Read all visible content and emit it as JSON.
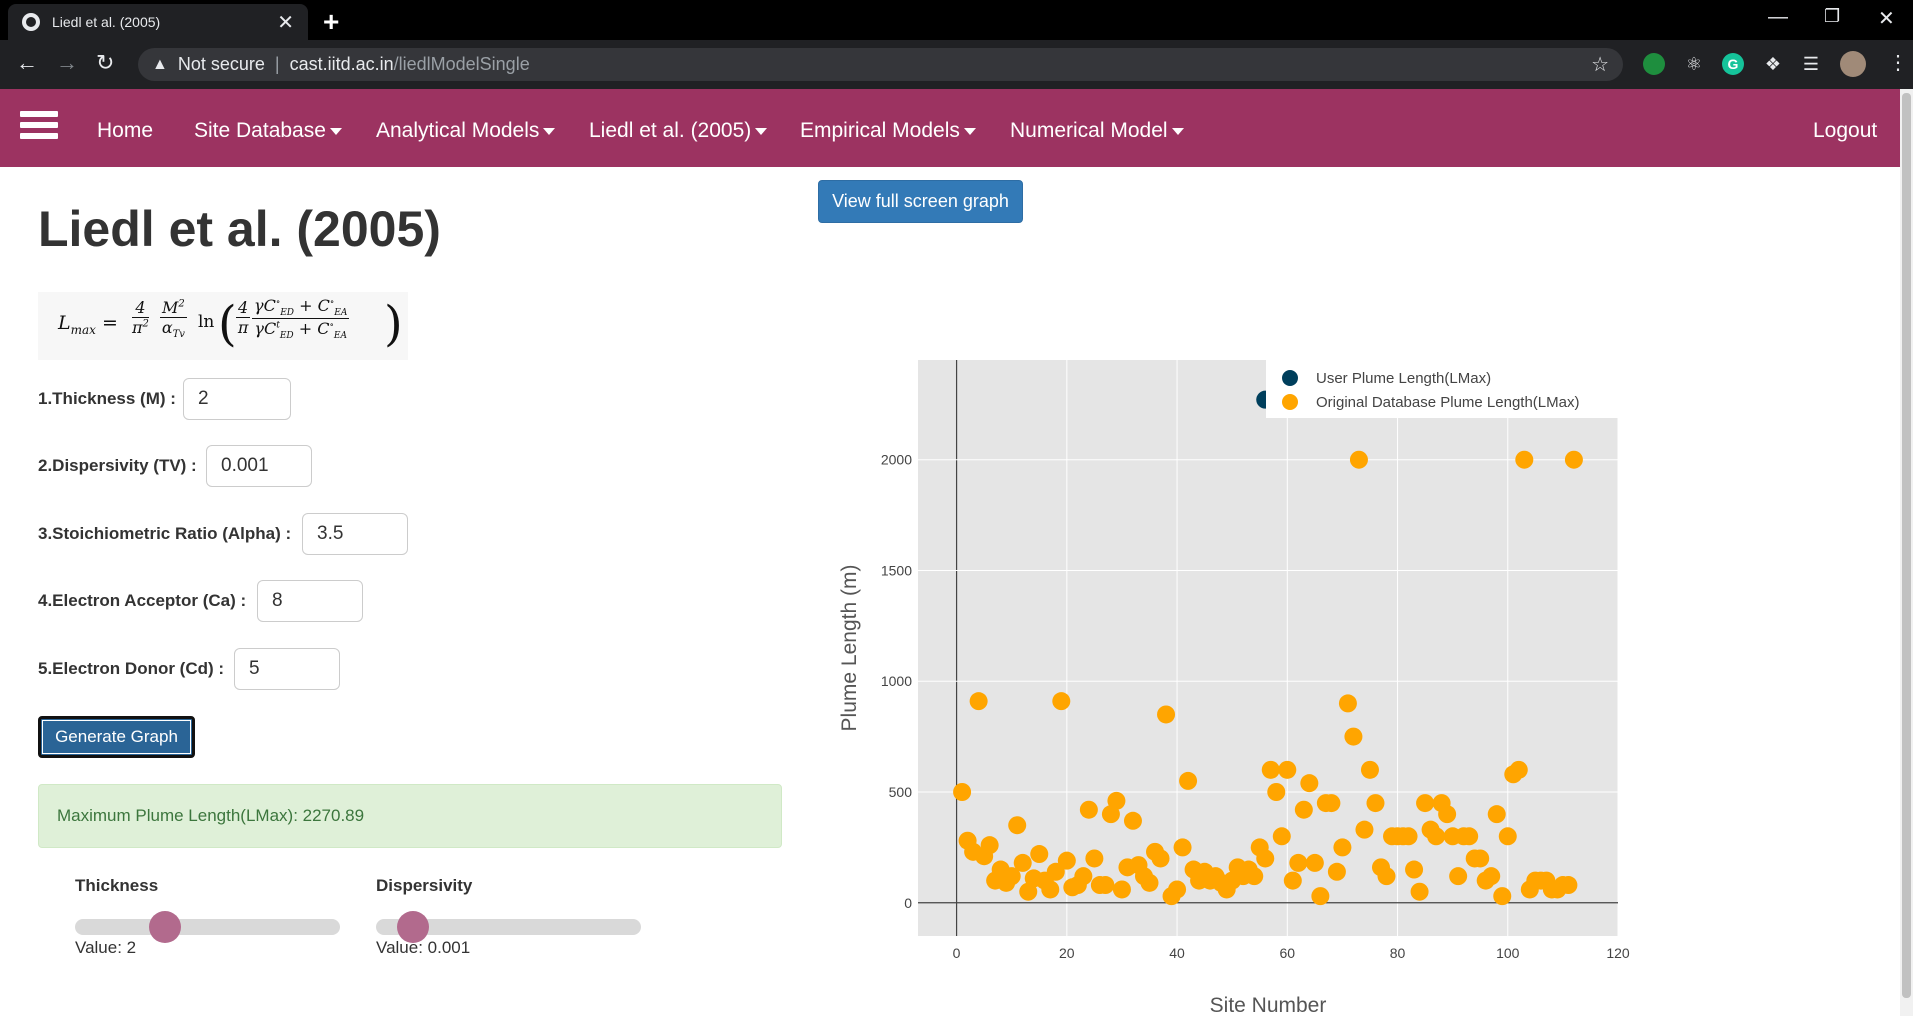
{
  "browser": {
    "tab_title": "Liedl et al. (2005)",
    "tab_close": "✕",
    "new_tab": "+",
    "security": "Not secure",
    "url_host": "cast.iitd.ac.in",
    "url_path": "/liedlModelSingle"
  },
  "nav": {
    "items": [
      {
        "label": "Home",
        "dropdown": false
      },
      {
        "label": "Site Database",
        "dropdown": true
      },
      {
        "label": "Analytical Models",
        "dropdown": true
      },
      {
        "label": "Liedl et al. (2005)",
        "dropdown": true
      },
      {
        "label": "Empirical Models",
        "dropdown": true
      },
      {
        "label": "Numerical Model",
        "dropdown": true
      }
    ],
    "logout": "Logout",
    "color": "#9c3361"
  },
  "page": {
    "title": "Liedl et al. (2005)",
    "fields": [
      {
        "label": "1.Thickness (M) :",
        "value": "2"
      },
      {
        "label": "2.Dispersivity (TV) :",
        "value": "0.001"
      },
      {
        "label": "3.Stoichiometric Ratio (Alpha) :",
        "value": "3.5"
      },
      {
        "label": "4.Electron Acceptor (Ca) :",
        "value": "8"
      },
      {
        "label": "5.Electron Donor (Cd) :",
        "value": "5"
      }
    ],
    "generate_button": "Generate Graph",
    "result_text": "Maximum Plume Length(LMax): 2270.89",
    "sliders": [
      {
        "label": "Thickness",
        "value_text": "Value: 2",
        "position": 0.34
      },
      {
        "label": "Dispersivity",
        "value_text": "Value: 0.001",
        "position": 0.14
      }
    ],
    "fullscreen_button": "View full screen graph"
  },
  "chart_data": {
    "type": "scatter",
    "xlabel": "Site Number",
    "ylabel": "Plume Length (m)",
    "xlim": [
      -7,
      120
    ],
    "ylim": [
      -150,
      2450
    ],
    "xticks": [
      0,
      20,
      40,
      60,
      80,
      100,
      120
    ],
    "yticks": [
      0,
      500,
      1000,
      1500,
      2000
    ],
    "legend_position": "top-right",
    "series": [
      {
        "name": "User Plume Length(LMax)",
        "color": "#003f5c",
        "points": [
          [
            56,
            2270.89
          ]
        ]
      },
      {
        "name": "Original Database Plume Length(LMax)",
        "color": "#ffa500",
        "points": [
          [
            1,
            500
          ],
          [
            2,
            280
          ],
          [
            3,
            230
          ],
          [
            4,
            910
          ],
          [
            5,
            210
          ],
          [
            6,
            260
          ],
          [
            7,
            100
          ],
          [
            8,
            150
          ],
          [
            9,
            90
          ],
          [
            10,
            120
          ],
          [
            11,
            350
          ],
          [
            12,
            180
          ],
          [
            13,
            50
          ],
          [
            14,
            110
          ],
          [
            15,
            220
          ],
          [
            16,
            100
          ],
          [
            17,
            60
          ],
          [
            18,
            140
          ],
          [
            19,
            910
          ],
          [
            20,
            190
          ],
          [
            21,
            70
          ],
          [
            22,
            80
          ],
          [
            23,
            120
          ],
          [
            24,
            420
          ],
          [
            25,
            200
          ],
          [
            26,
            80
          ],
          [
            27,
            80
          ],
          [
            28,
            400
          ],
          [
            29,
            460
          ],
          [
            30,
            60
          ],
          [
            31,
            160
          ],
          [
            32,
            370
          ],
          [
            33,
            170
          ],
          [
            34,
            120
          ],
          [
            35,
            90
          ],
          [
            36,
            230
          ],
          [
            37,
            200
          ],
          [
            38,
            850
          ],
          [
            39,
            30
          ],
          [
            40,
            60
          ],
          [
            41,
            250
          ],
          [
            42,
            550
          ],
          [
            43,
            150
          ],
          [
            44,
            100
          ],
          [
            45,
            140
          ],
          [
            46,
            100
          ],
          [
            47,
            120
          ],
          [
            48,
            90
          ],
          [
            49,
            60
          ],
          [
            50,
            100
          ],
          [
            51,
            160
          ],
          [
            52,
            120
          ],
          [
            53,
            150
          ],
          [
            54,
            120
          ],
          [
            55,
            250
          ],
          [
            56,
            200
          ],
          [
            57,
            600
          ],
          [
            58,
            500
          ],
          [
            59,
            300
          ],
          [
            60,
            600
          ],
          [
            61,
            100
          ],
          [
            62,
            180
          ],
          [
            63,
            420
          ],
          [
            64,
            540
          ],
          [
            65,
            180
          ],
          [
            66,
            30
          ],
          [
            67,
            450
          ],
          [
            68,
            450
          ],
          [
            69,
            140
          ],
          [
            70,
            250
          ],
          [
            71,
            900
          ],
          [
            72,
            750
          ],
          [
            73,
            2000
          ],
          [
            74,
            330
          ],
          [
            75,
            600
          ],
          [
            76,
            450
          ],
          [
            77,
            160
          ],
          [
            78,
            120
          ],
          [
            79,
            300
          ],
          [
            80,
            300
          ],
          [
            81,
            300
          ],
          [
            82,
            300
          ],
          [
            83,
            150
          ],
          [
            84,
            50
          ],
          [
            85,
            450
          ],
          [
            86,
            330
          ],
          [
            87,
            300
          ],
          [
            88,
            450
          ],
          [
            89,
            400
          ],
          [
            90,
            300
          ],
          [
            91,
            120
          ],
          [
            92,
            300
          ],
          [
            93,
            300
          ],
          [
            94,
            200
          ],
          [
            95,
            200
          ],
          [
            96,
            100
          ],
          [
            97,
            120
          ],
          [
            98,
            400
          ],
          [
            99,
            30
          ],
          [
            100,
            300
          ],
          [
            101,
            580
          ],
          [
            102,
            600
          ],
          [
            103,
            2000
          ],
          [
            104,
            60
          ],
          [
            105,
            100
          ],
          [
            106,
            100
          ],
          [
            107,
            100
          ],
          [
            108,
            60
          ],
          [
            109,
            60
          ],
          [
            110,
            80
          ],
          [
            111,
            80
          ],
          [
            112,
            2000
          ]
        ]
      }
    ]
  }
}
